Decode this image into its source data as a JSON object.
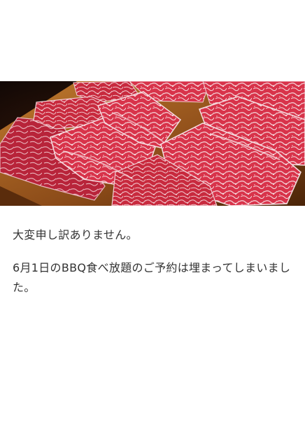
{
  "hero_image": {
    "icon": "wagyu-beef-photo"
  },
  "message": {
    "apology": "大変申し訳ありません。",
    "notice": "6月1日のBBQ食べ放題のご予約は埋まってしまいました。"
  }
}
